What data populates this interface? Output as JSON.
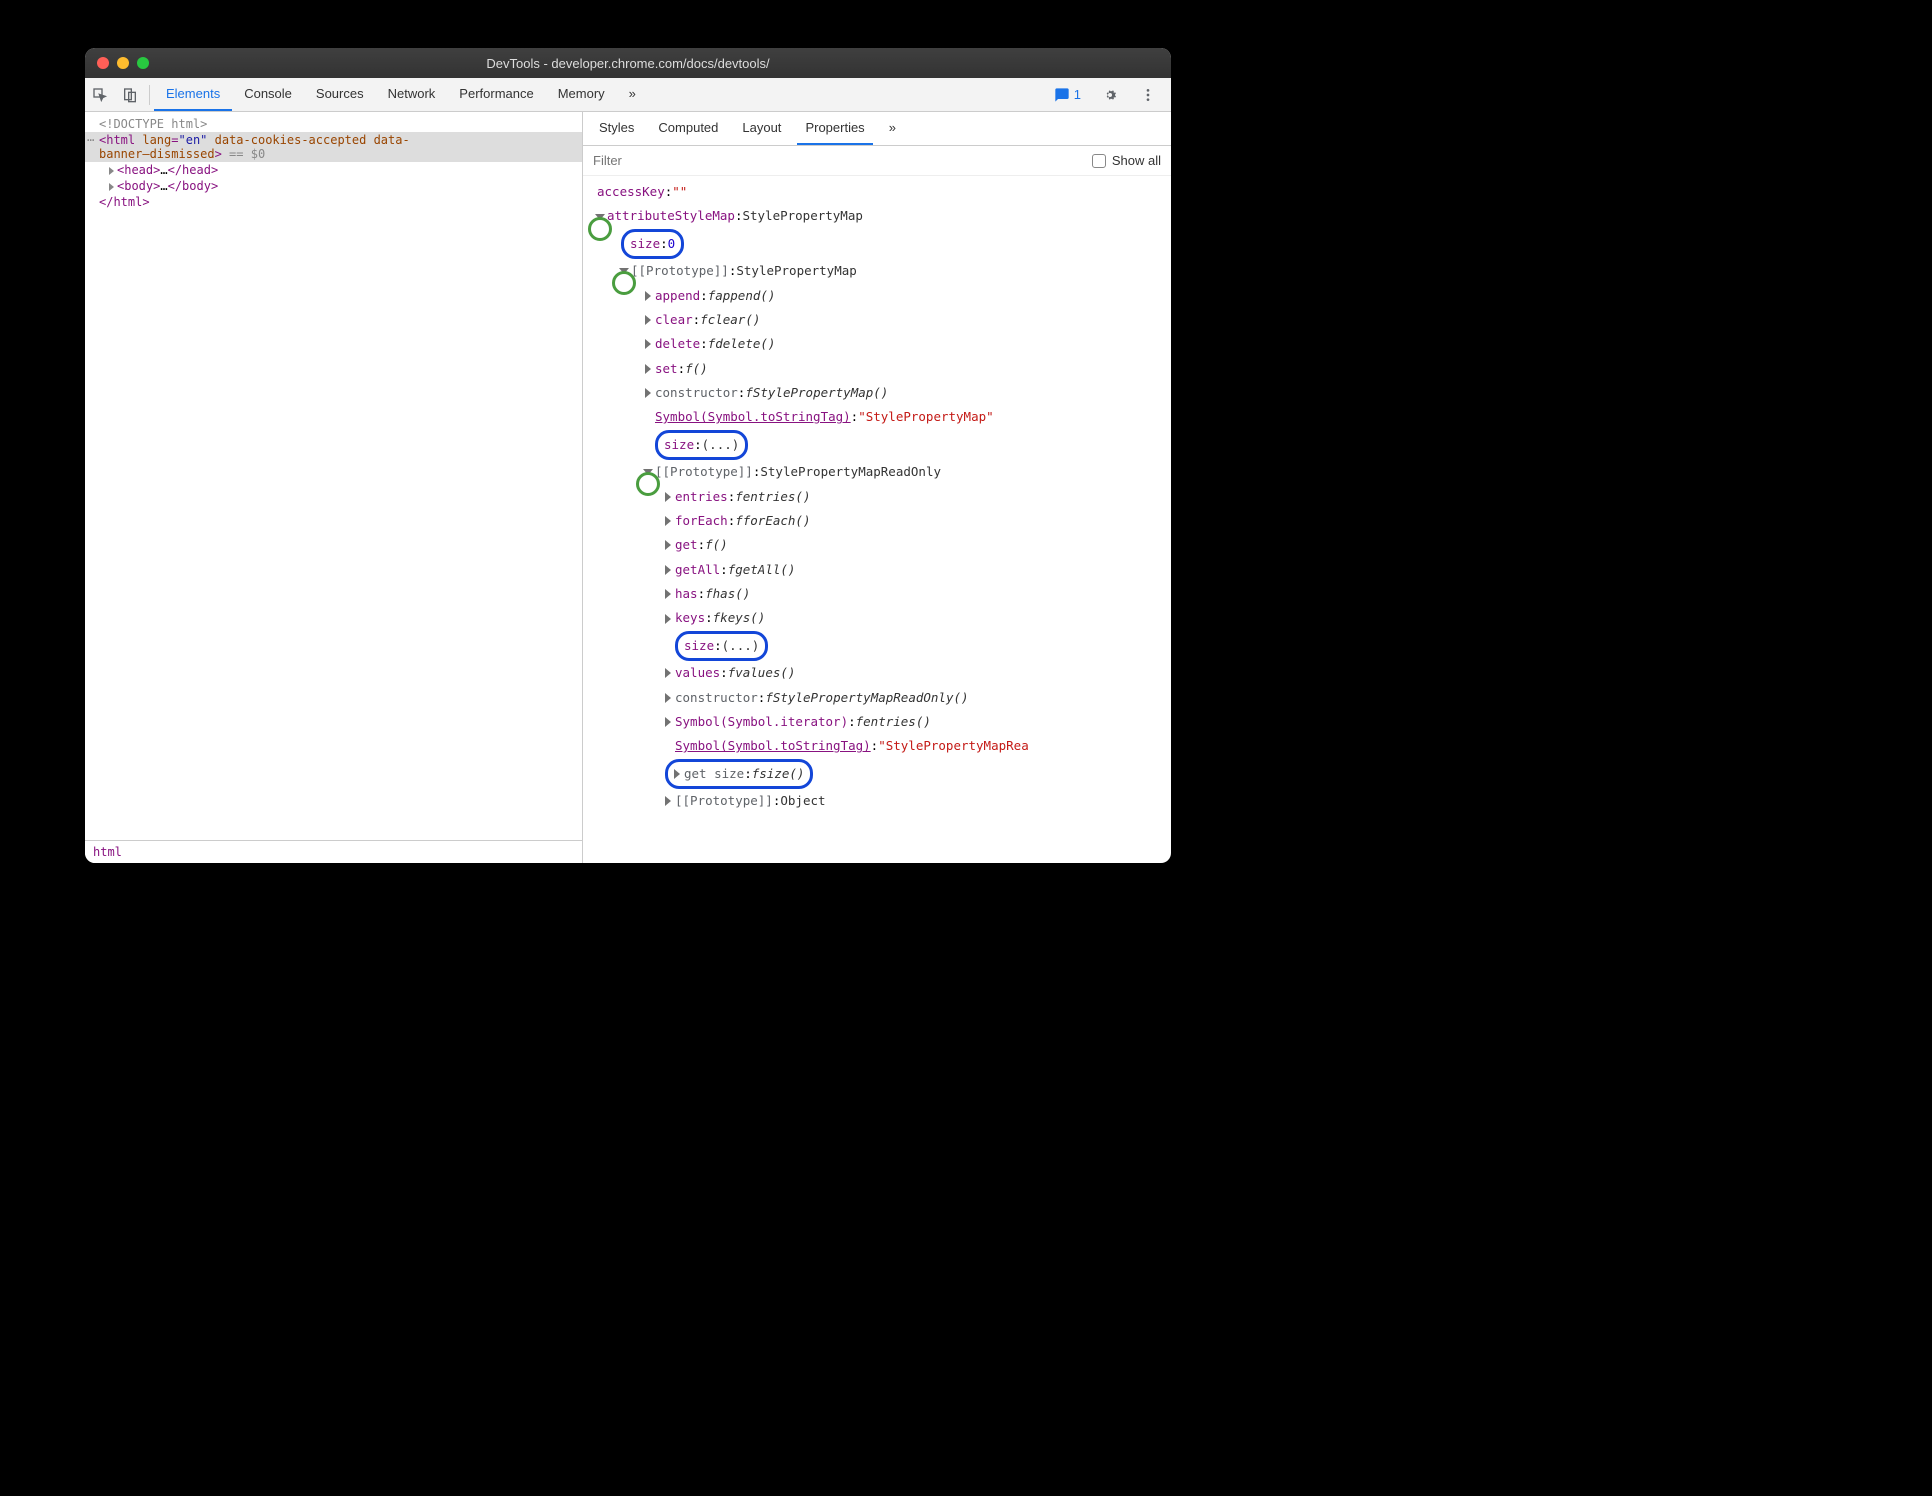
{
  "window": {
    "title": "DevTools - developer.chrome.com/docs/devtools/"
  },
  "toolbar": {
    "tabs": [
      "Elements",
      "Console",
      "Sources",
      "Network",
      "Performance",
      "Memory"
    ],
    "active": "Elements",
    "issues_count": "1"
  },
  "dom": {
    "doctype": "<!DOCTYPE html>",
    "html_open_1": "<html ",
    "html_attr_lang": "lang",
    "html_attr_lang_val": "\"en\"",
    "html_attr_cookies": " data-cookies-accepted data-",
    "html_open_2": "banner–dismissed",
    "html_close_gt": ">",
    "sel_marker": " == $0",
    "head": "<head>",
    "head_ell": "…",
    "head_close": "</head>",
    "body": "<body>",
    "body_ell": "…",
    "body_close": "</body>",
    "html_close": "</html>",
    "breadcrumb": "html"
  },
  "side_tabs": {
    "items": [
      "Styles",
      "Computed",
      "Layout",
      "Properties"
    ],
    "active": "Properties"
  },
  "filter": {
    "placeholder": "Filter",
    "show_all": "Show all"
  },
  "props": {
    "accessKey": {
      "name": "accessKey",
      "value": "\"\""
    },
    "attributeStyleMap": {
      "name": "attributeStyleMap",
      "value": "StylePropertyMap"
    },
    "size0": {
      "name": "size",
      "value": "0"
    },
    "proto1": {
      "name": "[[Prototype]]",
      "value": "StylePropertyMap"
    },
    "append": {
      "name": "append",
      "fn": "append()"
    },
    "clear": {
      "name": "clear",
      "fn": "clear()"
    },
    "delete": {
      "name": "delete",
      "fn": "delete()"
    },
    "set": {
      "name": "set",
      "fn": "()"
    },
    "ctor1": {
      "name": "constructor",
      "fn": "StylePropertyMap()"
    },
    "symTag1": {
      "name": "Symbol(Symbol.toStringTag)",
      "value": "\"StylePropertyMap\""
    },
    "sizeEll1": {
      "name": "size",
      "value": "(...)"
    },
    "proto2": {
      "name": "[[Prototype]]",
      "value": "StylePropertyMapReadOnly"
    },
    "entries": {
      "name": "entries",
      "fn": "entries()"
    },
    "forEach": {
      "name": "forEach",
      "fn": "forEach()"
    },
    "get": {
      "name": "get",
      "fn": "()"
    },
    "getAll": {
      "name": "getAll",
      "fn": "getAll()"
    },
    "has": {
      "name": "has",
      "fn": "has()"
    },
    "keys": {
      "name": "keys",
      "fn": "keys()"
    },
    "sizeEll2": {
      "name": "size",
      "value": "(...)"
    },
    "values": {
      "name": "values",
      "fn": "values()"
    },
    "ctor2": {
      "name": "constructor",
      "fn": "StylePropertyMapReadOnly()"
    },
    "symIter": {
      "name": "Symbol(Symbol.iterator)",
      "fn": "entries()"
    },
    "symTag2": {
      "name": "Symbol(Symbol.toStringTag)",
      "value": "\"StylePropertyMapRea"
    },
    "getSize": {
      "name": "get size",
      "fn": "size()"
    },
    "proto3": {
      "name": "[[Prototype]]",
      "value": "Object"
    }
  }
}
